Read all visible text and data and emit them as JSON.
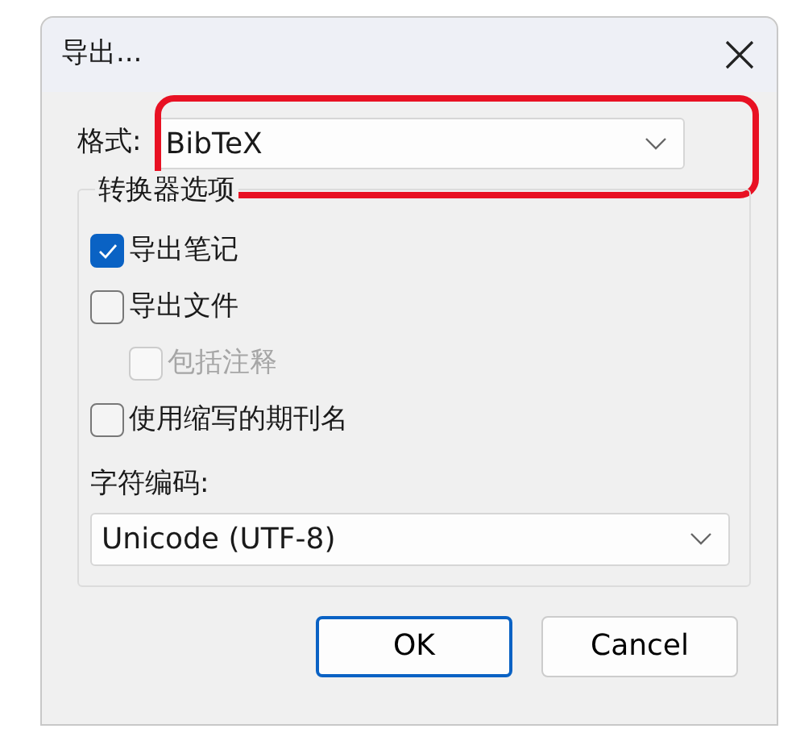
{
  "window": {
    "title": "导出..."
  },
  "format": {
    "label": "格式:",
    "value": "BibTeX",
    "highlighted": true
  },
  "options_group": {
    "title": "转换器选项",
    "options": [
      {
        "label": "导出笔记",
        "checked": true,
        "disabled": false,
        "indented": false
      },
      {
        "label": "导出文件",
        "checked": false,
        "disabled": false,
        "indented": false
      },
      {
        "label": "包括注释",
        "checked": false,
        "disabled": true,
        "indented": true
      },
      {
        "label": "使用缩写的期刊名",
        "checked": false,
        "disabled": false,
        "indented": false
      }
    ],
    "encoding": {
      "label": "字符编码:",
      "value": "Unicode (UTF-8)"
    }
  },
  "buttons": [
    {
      "label": "OK",
      "default": true
    },
    {
      "label": "Cancel",
      "default": false
    }
  ]
}
